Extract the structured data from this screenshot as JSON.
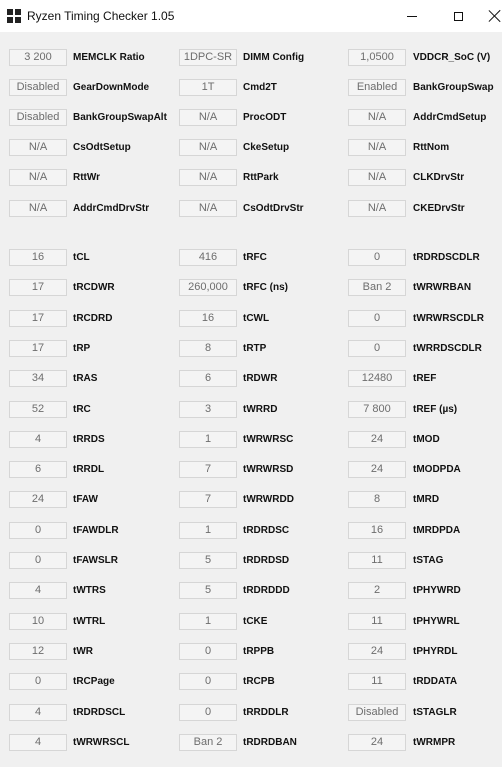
{
  "window": {
    "title": "Ryzen Timing Checker 1.05",
    "controls": {
      "minimize": "minimize",
      "maximize": "maximize",
      "close": "close"
    }
  },
  "config_rows": [
    [
      {
        "value": "3 200",
        "label": "MEMCLK Ratio"
      },
      {
        "value": "1DPC-SR",
        "label": "DIMM Config"
      },
      {
        "value": "1,0500",
        "label": "VDDCR_SoC (V)"
      }
    ],
    [
      {
        "value": "Disabled",
        "label": "GearDownMode"
      },
      {
        "value": "1T",
        "label": "Cmd2T"
      },
      {
        "value": "Enabled",
        "label": "BankGroupSwap"
      }
    ],
    [
      {
        "value": "Disabled",
        "label": "BankGroupSwapAlt"
      },
      {
        "value": "N/A",
        "label": "ProcODT"
      },
      {
        "value": "N/A",
        "label": "AddrCmdSetup"
      }
    ],
    [
      {
        "value": "N/A",
        "label": "CsOdtSetup"
      },
      {
        "value": "N/A",
        "label": "CkeSetup"
      },
      {
        "value": "N/A",
        "label": "RttNom"
      }
    ],
    [
      {
        "value": "N/A",
        "label": "RttWr"
      },
      {
        "value": "N/A",
        "label": "RttPark"
      },
      {
        "value": "N/A",
        "label": "CLKDrvStr"
      }
    ],
    [
      {
        "value": "N/A",
        "label": "AddrCmdDrvStr"
      },
      {
        "value": "N/A",
        "label": "CsOdtDrvStr"
      },
      {
        "value": "N/A",
        "label": "CKEDrvStr"
      }
    ]
  ],
  "timing_rows": [
    [
      {
        "value": "16",
        "label": "tCL"
      },
      {
        "value": "416",
        "label": "tRFC"
      },
      {
        "value": "0",
        "label": "tRDRDSCDLR"
      }
    ],
    [
      {
        "value": "17",
        "label": "tRCDWR"
      },
      {
        "value": "260,000",
        "label": "tRFC (ns)"
      },
      {
        "value": "Ban 2",
        "label": "tWRWRBAN"
      }
    ],
    [
      {
        "value": "17",
        "label": "tRCDRD"
      },
      {
        "value": "16",
        "label": "tCWL"
      },
      {
        "value": "0",
        "label": "tWRWRSCDLR"
      }
    ],
    [
      {
        "value": "17",
        "label": "tRP"
      },
      {
        "value": "8",
        "label": "tRTP"
      },
      {
        "value": "0",
        "label": "tWRRDSCDLR"
      }
    ],
    [
      {
        "value": "34",
        "label": "tRAS"
      },
      {
        "value": "6",
        "label": "tRDWR"
      },
      {
        "value": "12480",
        "label": "tREF"
      }
    ],
    [
      {
        "value": "52",
        "label": "tRC"
      },
      {
        "value": "3",
        "label": "tWRRD"
      },
      {
        "value": "7 800",
        "label": "tREF (µs)"
      }
    ],
    [
      {
        "value": "4",
        "label": "tRRDS"
      },
      {
        "value": "1",
        "label": "tWRWRSC"
      },
      {
        "value": "24",
        "label": "tMOD"
      }
    ],
    [
      {
        "value": "6",
        "label": "tRRDL"
      },
      {
        "value": "7",
        "label": "tWRWRSD"
      },
      {
        "value": "24",
        "label": "tMODPDA"
      }
    ],
    [
      {
        "value": "24",
        "label": "tFAW"
      },
      {
        "value": "7",
        "label": "tWRWRDD"
      },
      {
        "value": "8",
        "label": "tMRD"
      }
    ],
    [
      {
        "value": "0",
        "label": "tFAWDLR"
      },
      {
        "value": "1",
        "label": "tRDRDSC"
      },
      {
        "value": "16",
        "label": "tMRDPDA"
      }
    ],
    [
      {
        "value": "0",
        "label": "tFAWSLR"
      },
      {
        "value": "5",
        "label": "tRDRDSD"
      },
      {
        "value": "11",
        "label": "tSTAG"
      }
    ],
    [
      {
        "value": "4",
        "label": "tWTRS"
      },
      {
        "value": "5",
        "label": "tRDRDDD"
      },
      {
        "value": "2",
        "label": "tPHYWRD"
      }
    ],
    [
      {
        "value": "10",
        "label": "tWTRL"
      },
      {
        "value": "1",
        "label": "tCKE"
      },
      {
        "value": "11",
        "label": "tPHYWRL"
      }
    ],
    [
      {
        "value": "12",
        "label": "tWR"
      },
      {
        "value": "0",
        "label": "tRPPB"
      },
      {
        "value": "24",
        "label": "tPHYRDL"
      }
    ],
    [
      {
        "value": "0",
        "label": "tRCPage"
      },
      {
        "value": "0",
        "label": "tRCPB"
      },
      {
        "value": "11",
        "label": "tRDDATA"
      }
    ],
    [
      {
        "value": "4",
        "label": "tRDRDSCL"
      },
      {
        "value": "0",
        "label": "tRRDDLR"
      },
      {
        "value": "Disabled",
        "label": "tSTAGLR"
      }
    ],
    [
      {
        "value": "4",
        "label": "tWRWRSCL"
      },
      {
        "value": "Ban 2",
        "label": "tRDRDBAN"
      },
      {
        "value": "24",
        "label": "tWRMPR"
      }
    ]
  ]
}
